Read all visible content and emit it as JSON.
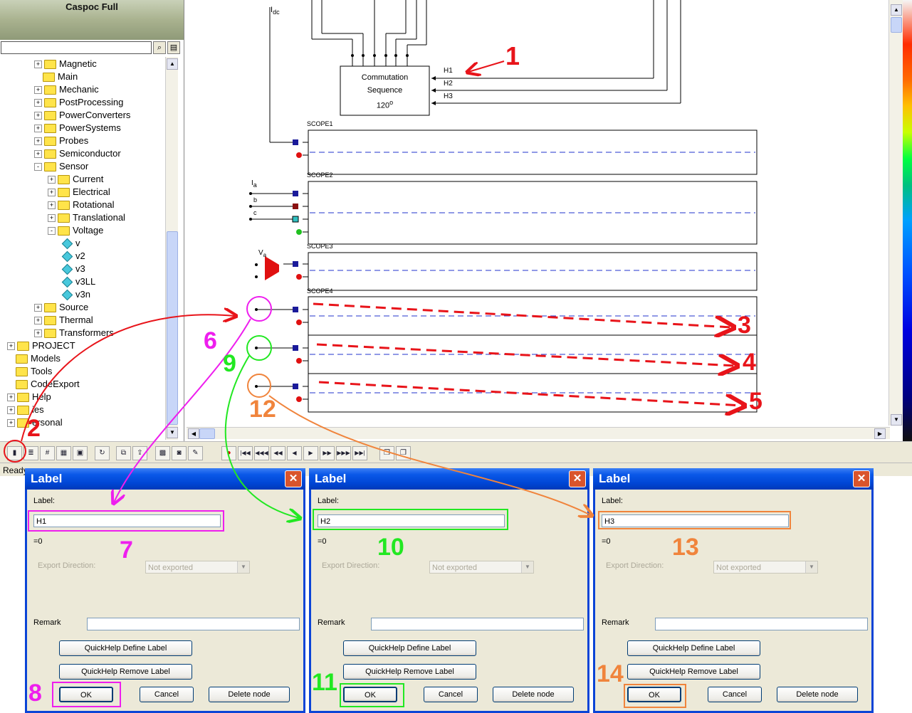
{
  "app": {
    "title": "Caspoc Full"
  },
  "tree": {
    "items": [
      {
        "label": "Magnetic",
        "type": "folder",
        "exp": "+"
      },
      {
        "label": "Main",
        "type": "folder",
        "exp": ""
      },
      {
        "label": "Mechanic",
        "type": "folder",
        "exp": "+"
      },
      {
        "label": "PostProcessing",
        "type": "folder",
        "exp": "+"
      },
      {
        "label": "PowerConverters",
        "type": "folder",
        "exp": "+"
      },
      {
        "label": "PowerSystems",
        "type": "folder",
        "exp": "+"
      },
      {
        "label": "Probes",
        "type": "folder",
        "exp": "+"
      },
      {
        "label": "Semiconductor",
        "type": "folder",
        "exp": "+"
      },
      {
        "label": "Sensor",
        "type": "folder",
        "exp": "-"
      },
      {
        "label": "Current",
        "type": "folder",
        "exp": "+"
      },
      {
        "label": "Electrical",
        "type": "folder",
        "exp": "+"
      },
      {
        "label": "Rotational",
        "type": "folder",
        "exp": "+"
      },
      {
        "label": "Translational",
        "type": "folder",
        "exp": "+"
      },
      {
        "label": "Voltage",
        "type": "folder",
        "exp": "-"
      },
      {
        "label": "v",
        "type": "leaf",
        "exp": ""
      },
      {
        "label": "v2",
        "type": "leaf",
        "exp": ""
      },
      {
        "label": "v3",
        "type": "leaf",
        "exp": ""
      },
      {
        "label": "v3LL",
        "type": "leaf",
        "exp": ""
      },
      {
        "label": "v3n",
        "type": "leaf",
        "exp": ""
      },
      {
        "label": "Source",
        "type": "folder",
        "exp": "+"
      },
      {
        "label": "Thermal",
        "type": "folder",
        "exp": "+"
      },
      {
        "label": "Transformers",
        "type": "folder",
        "exp": "+"
      },
      {
        "label": "PROJECT",
        "type": "folder",
        "exp": "+"
      },
      {
        "label": "Models",
        "type": "folder",
        "exp": ""
      },
      {
        "label": "Tools",
        "type": "folder",
        "exp": ""
      },
      {
        "label": "CodeExport",
        "type": "folder",
        "exp": ""
      },
      {
        "label": "Help",
        "type": "folder",
        "exp": "+"
      },
      {
        "label": "ies",
        "type": "folder",
        "exp": "+"
      },
      {
        "label": "ersonal",
        "type": "folder",
        "exp": "+"
      }
    ]
  },
  "schematic": {
    "idc_label": "I",
    "idc_sub": "dc",
    "commutation": {
      "line1": "Commutation",
      "line2": "Sequence",
      "line3": "120",
      "deg": "o"
    },
    "h_labels": [
      "H1",
      "H2",
      "H3"
    ],
    "scopes": [
      "SCOPE1",
      "SCOPE2",
      "SCOPE3",
      "SCOPE4"
    ],
    "i_labels": {
      "i": "I",
      "a": "a",
      "b": "b",
      "c": "c"
    },
    "v_label": "V",
    "v_sub": "a"
  },
  "toolbar": {
    "icons": [
      "open-icon",
      "list-icon",
      "number-icon",
      "grid-icon",
      "chip-icon",
      "refresh-icon",
      "network-icon",
      "export-icon",
      "image-icon",
      "camera-icon",
      "brush-icon"
    ],
    "media": [
      "|◀◀",
      "◀◀◀",
      "◀◀",
      "◀",
      "▶",
      "▶▶",
      "▶▶▶",
      "▶▶|"
    ]
  },
  "status": {
    "text": "Ready"
  },
  "dialogs": [
    {
      "title": "Label",
      "label_caption": "Label:",
      "value": "H1",
      "eq_text": "=0",
      "export_caption": "Export Direction:",
      "export_value": "Not exported",
      "remark_caption": "Remark",
      "remark_value": "",
      "btn_define": "QuickHelp Define Label",
      "btn_remove": "QuickHelp Remove Label",
      "btn_ok": "OK",
      "btn_cancel": "Cancel",
      "btn_delete": "Delete node"
    },
    {
      "title": "Label",
      "label_caption": "Label:",
      "value": "H2",
      "eq_text": "=0",
      "export_caption": "Export Direction:",
      "export_value": "Not exported",
      "remark_caption": "Remark",
      "remark_value": "",
      "btn_define": "QuickHelp Define Label",
      "btn_remove": "QuickHelp Remove Label",
      "btn_ok": "OK",
      "btn_cancel": "Cancel",
      "btn_delete": "Delete node"
    },
    {
      "title": "Label",
      "label_caption": "Label:",
      "value": "H3",
      "eq_text": "=0",
      "export_caption": "Export Direction:",
      "export_value": "Not exported",
      "remark_caption": "Remark",
      "remark_value": "",
      "btn_define": "QuickHelp Define Label",
      "btn_remove": "QuickHelp Remove Label",
      "btn_ok": "OK",
      "btn_cancel": "Cancel",
      "btn_delete": "Delete node"
    }
  ],
  "annotations": {
    "n1": "1",
    "n2": "2",
    "n3": "3",
    "n4": "4",
    "n5": "5",
    "n6": "6",
    "n7": "7",
    "n8": "8",
    "n9": "9",
    "n10": "10",
    "n11": "11",
    "n12": "12",
    "n13": "13",
    "n14": "14",
    "colors": {
      "red": "#e8141a",
      "magenta": "#ee1eee",
      "green": "#22e822",
      "orange": "#f0843c"
    }
  }
}
